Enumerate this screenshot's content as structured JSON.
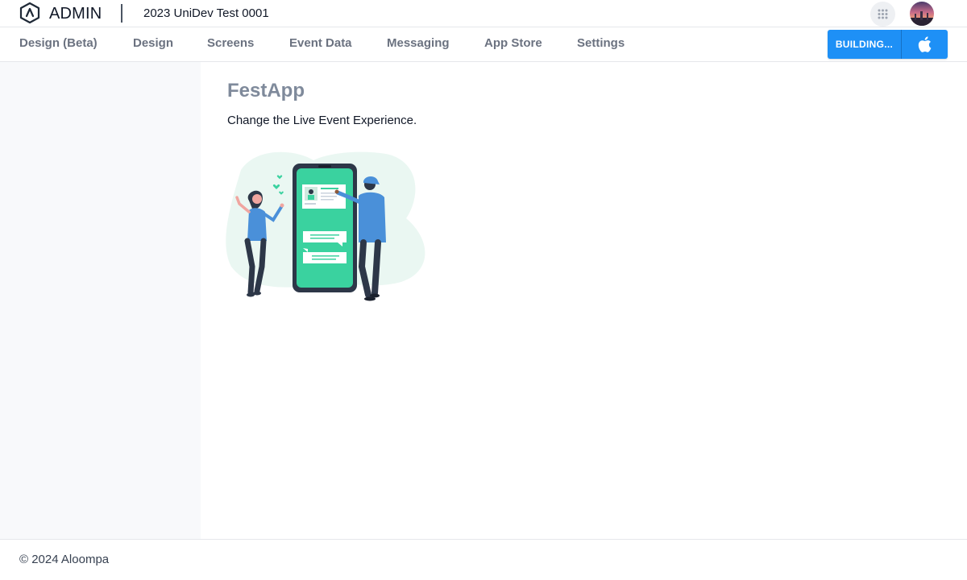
{
  "header": {
    "brand": "ADMIN",
    "project_name": "2023 UniDev Test 0001",
    "apps_icon": "grid-icon",
    "avatar": "user-avatar"
  },
  "nav": {
    "items": [
      {
        "label": "Design (Beta)"
      },
      {
        "label": "Design"
      },
      {
        "label": "Screens"
      },
      {
        "label": "Event Data"
      },
      {
        "label": "Messaging"
      },
      {
        "label": "App Store"
      },
      {
        "label": "Settings"
      }
    ],
    "build_button_label": "BUILDING...",
    "platform_icon": "apple-icon"
  },
  "main": {
    "title": "FestApp",
    "subtitle": "Change the Live Event Experience."
  },
  "footer": {
    "copyright": "© 2024 Aloompa"
  },
  "colors": {
    "accent": "#1e90f6",
    "phone_screen": "#3ad29f",
    "title": "#7f8a9b",
    "sidebar_bg": "#f8f9fb"
  }
}
